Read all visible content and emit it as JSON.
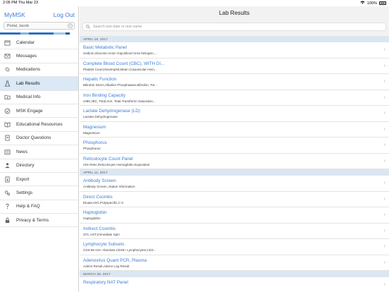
{
  "status": {
    "time": "2:05 PM  Thu Mar 23",
    "battery": "100%"
  },
  "sidebar": {
    "brand_my": "My",
    "brand_msk": "MSK",
    "logout": "Log Out",
    "portal": "Portal, Jacob",
    "stripe_colors": [
      "#2a6fc4",
      "#7fb5e6",
      "#2a6fc4",
      "#9bc8ee",
      "#1f5aa6"
    ],
    "items": [
      {
        "label": "Calendar",
        "icon": "calendar-icon"
      },
      {
        "label": "Messages",
        "icon": "envelope-icon"
      },
      {
        "label": "Medications",
        "icon": "pill-icon"
      },
      {
        "label": "Lab Results",
        "icon": "flask-icon"
      },
      {
        "label": "Medical Info",
        "icon": "folder-medical-icon"
      },
      {
        "label": "MSK Engage",
        "icon": "engage-icon"
      },
      {
        "label": "Educational Resources",
        "icon": "book-icon"
      },
      {
        "label": "Doctor Questions",
        "icon": "document-icon"
      },
      {
        "label": "News",
        "icon": "newspaper-icon"
      },
      {
        "label": "Directory",
        "icon": "person-icon"
      },
      {
        "label": "Export",
        "icon": "export-icon"
      },
      {
        "label": "Settings",
        "icon": "gear-icon"
      },
      {
        "label": "Help & FAQ",
        "icon": "question-icon"
      },
      {
        "label": "Privacy & Terms",
        "icon": "lock-icon"
      }
    ],
    "active_index": 3
  },
  "main": {
    "title": "Lab Results",
    "search_placeholder": "Search test date or test name",
    "sections": [
      {
        "date": "APRIL 19, 2017",
        "rows": [
          {
            "name": "Basic Metabolic Panel",
            "sub": "Sodium,Glucose,Anion Gap,Blood Urea Nitrogen,..."
          },
          {
            "name": "Complete Blood Count (CBC), WITH Di...",
            "sub": "Platelet Count,Neutrophil,Mean Corpuscular Hem..."
          },
          {
            "name": "Hepatic Function",
            "sub": "Bilirubin Direct,Alkaline Phosphatase,Bilirubin, Tot..."
          },
          {
            "name": "Iron Binding Capacity",
            "sub": "UIBC,IBC, Total,Iron, Total,Transferrin Saturation..."
          },
          {
            "name": "Lactate Dehydrogenase (LD)",
            "sub": "Lactate Dehydrogenase"
          },
          {
            "name": "Magnesium",
            "sub": "Magnesium"
          },
          {
            "name": "Phosphorus",
            "sub": "Phosphorus"
          },
          {
            "name": "Reticulocyte Count Panel",
            "sub": "Abs Retic,Reticulocyte Hemoglobin Equivalent"
          }
        ]
      },
      {
        "date": "APRIL 11, 2017",
        "rows": [
          {
            "name": "Antibody Screen.",
            "sub": "Antibody Screen.,Status Information"
          },
          {
            "name": "Direct Coombs",
            "sub": "Eluate,IGG,Polyspecific,C-3"
          },
          {
            "name": "Haptoglobin",
            "sub": "Haptoglobin"
          },
          {
            "name": "Indirect Coombs",
            "sub": "37C,AGT,Immediate Spin"
          },
          {
            "name": "Lymphocyte Subsets",
            "sub": "CD3-56+16+ Absolute,CD45+ Lymphocytes,CD3..."
          },
          {
            "name": "Adenovirus Quant PCR, Plasma",
            "sub": "Adeno Result,Adeno Log Result"
          }
        ]
      },
      {
        "date": "MARCH 28, 2017",
        "rows": [
          {
            "name": "Respiratory NAT Panel",
            "sub": ""
          }
        ]
      }
    ]
  }
}
